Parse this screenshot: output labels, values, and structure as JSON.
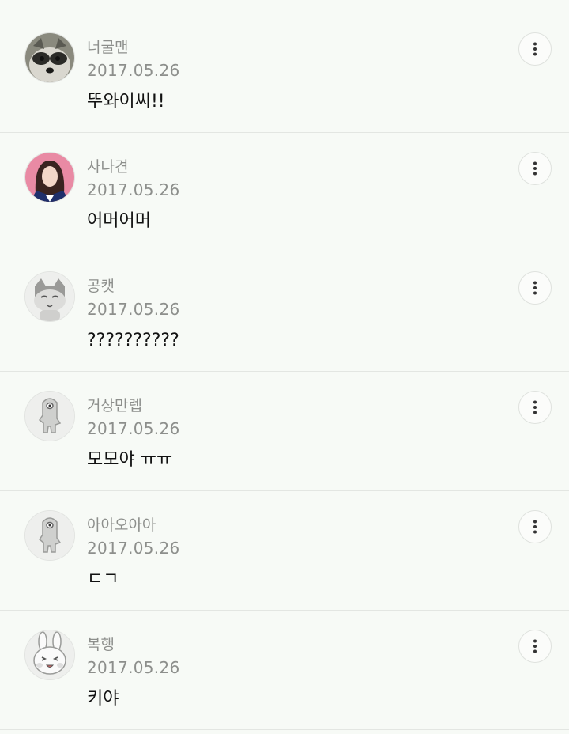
{
  "comments": [
    {
      "author": "너굴맨",
      "date": "2017.05.26",
      "text": "뚜와이씨!!",
      "avatar_icon": "raccoon-avatar-icon"
    },
    {
      "author": "사나견",
      "date": "2017.05.26",
      "text": "어머어머",
      "avatar_icon": "photo-avatar-icon"
    },
    {
      "author": "공캣",
      "date": "2017.05.26",
      "text": "??????????",
      "avatar_icon": "cat-avatar-icon"
    },
    {
      "author": "거상만렙",
      "date": "2017.05.26",
      "text": "모모야 ㅠㅠ",
      "avatar_icon": "one-eyed-creature-avatar-icon"
    },
    {
      "author": "아아오아아",
      "date": "2017.05.26",
      "text": "ㄷㄱ",
      "avatar_icon": "one-eyed-creature-avatar-icon"
    },
    {
      "author": "복행",
      "date": "2017.05.26",
      "text": "키야",
      "avatar_icon": "rabbit-avatar-icon"
    }
  ],
  "more_icon": "more-vertical-icon"
}
